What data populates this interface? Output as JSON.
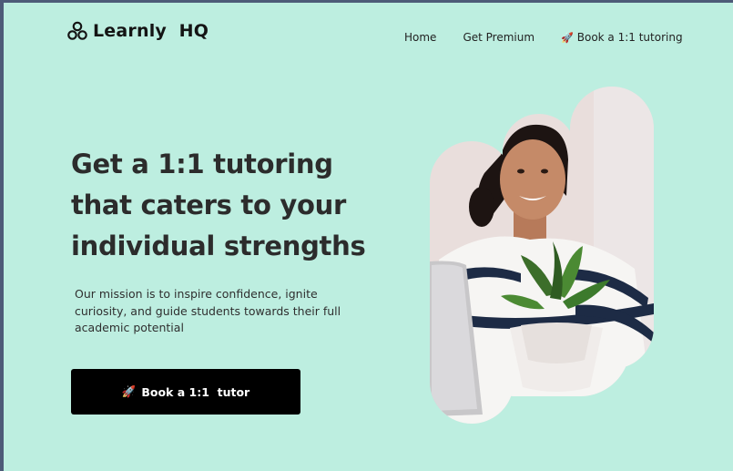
{
  "brand": {
    "name": "Learnly  HQ",
    "icon": "three-circles-logo-icon"
  },
  "nav": {
    "home": "Home",
    "premium": "Get Premium",
    "book": "Book a 1:1 tutoring",
    "book_icon": "🚀"
  },
  "hero": {
    "headline": "Get a 1:1 tutoring that caters to your individual strengths",
    "mission": "Our mission is to inspire confidence, ignite curiosity, and guide students towards their full academic potential",
    "cta_icon": "🚀",
    "cta_label": "Book a 1:1  tutor",
    "image": "smiling-student-with-laptop-and-plant-photo"
  },
  "colors": {
    "background": "#bdeee0",
    "frame": "#4d5b78",
    "cta_background": "#000000",
    "text": "#2c2c2c"
  }
}
